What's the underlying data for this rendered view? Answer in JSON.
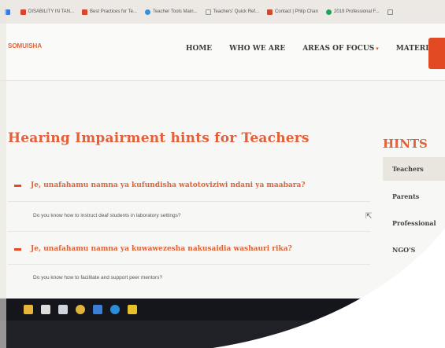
{
  "bookmarks": [
    {
      "label": "",
      "color": "#3c7ad9"
    },
    {
      "label": "DISABILITY IN TAN...",
      "color": "#d9462b"
    },
    {
      "label": "Best Practices for Te...",
      "color": "#d9462b"
    },
    {
      "label": "Teacher Tools Main...",
      "color": "#3a8fd6"
    },
    {
      "label": "Teachers' Quick Ref...",
      "color": "#999999"
    },
    {
      "label": "Contact | Phlip Chan",
      "color": "#d9462b"
    },
    {
      "label": "2019 Professional F...",
      "color": "#2a9d5a"
    },
    {
      "label": "",
      "color": "#888888"
    }
  ],
  "header": {
    "logo_alt": "SOMUISHA",
    "nav": [
      {
        "label": "HOME"
      },
      {
        "label": "WHO WE ARE"
      },
      {
        "label": "AREAS OF FOCUS",
        "caret": "▾"
      },
      {
        "label": "MATERIALS"
      }
    ]
  },
  "main": {
    "title": "Hearing Impairment hints for Teachers",
    "faqs": [
      {
        "question": "Je, unafahamu namna ya kufundisha watotoviziwi ndani ya maabara?",
        "answer": "Do you know how to instruct deaf students in laboratory settings?"
      },
      {
        "question": "Je, unafahamu namna ya kuwawezesha nakusaidia washauri rika?",
        "answer": "Do you know how to facilitate and support peer mentors?"
      }
    ]
  },
  "sidebar": {
    "title": "HINTS",
    "items": [
      {
        "label": "Teachers",
        "active": true
      },
      {
        "label": "Parents"
      },
      {
        "label": "Professional"
      },
      {
        "label": "NGO'S"
      }
    ]
  },
  "colors": {
    "accent": "#e2603a",
    "cta": "#e24a24",
    "taskbar": "#15161c"
  }
}
